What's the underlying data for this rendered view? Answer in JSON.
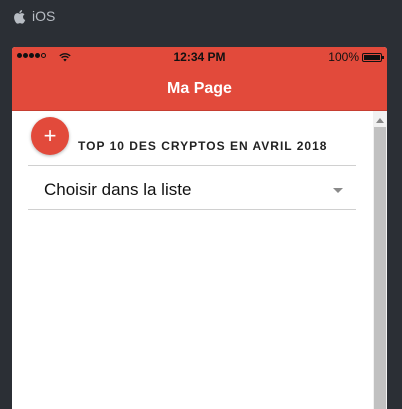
{
  "platform": {
    "label": "iOS",
    "icon": "apple-icon"
  },
  "status_bar": {
    "time": "12:34 PM",
    "battery": "100%",
    "battery_level": 1.0,
    "signal_bars_filled": 4,
    "signal_bars_total": 5
  },
  "navbar": {
    "title": "Ma Page",
    "color": "#e24a3b"
  },
  "content": {
    "add_button_symbol": "+",
    "section_title": "TOP 10 DES CRYPTOS EN AVRIL 2018",
    "picker": {
      "placeholder": "Choisir dans la liste"
    }
  }
}
